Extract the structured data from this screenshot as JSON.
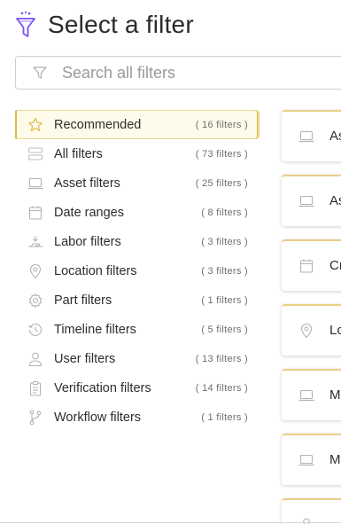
{
  "header": {
    "title": "Select a filter",
    "logo_icon": "funnel-icon"
  },
  "search": {
    "placeholder": "Search all filters",
    "value": "",
    "icon": "filter-icon"
  },
  "categories": [
    {
      "label": "Recommended",
      "count": "( 16 filters )",
      "icon": "star-icon",
      "active": true
    },
    {
      "label": "All filters",
      "count": "( 73 filters )",
      "icon": "stack-icon"
    },
    {
      "label": "Asset filters",
      "count": "( 25 filters )",
      "icon": "laptop-icon"
    },
    {
      "label": "Date ranges",
      "count": "( 8 filters )",
      "icon": "calendar-icon"
    },
    {
      "label": "Labor filters",
      "count": "( 3 filters )",
      "icon": "hand-icon"
    },
    {
      "label": "Location filters",
      "count": "( 3 filters )",
      "icon": "location-pin-icon"
    },
    {
      "label": "Part filters",
      "count": "( 1 filters )",
      "icon": "gear-icon"
    },
    {
      "label": "Timeline filters",
      "count": "( 5 filters )",
      "icon": "history-icon"
    },
    {
      "label": "User filters",
      "count": "( 13 filters )",
      "icon": "user-icon"
    },
    {
      "label": "Verification filters",
      "count": "( 14 filters )",
      "icon": "clipboard-icon"
    },
    {
      "label": "Workflow filters",
      "count": "( 1 filters )",
      "icon": "branch-icon"
    }
  ],
  "cards": [
    {
      "label": "As",
      "icon": "laptop-icon"
    },
    {
      "label": "As",
      "icon": "laptop-icon"
    },
    {
      "label": "Cr",
      "icon": "calendar-icon"
    },
    {
      "label": "Lo",
      "icon": "location-pin-icon"
    },
    {
      "label": "M",
      "icon": "laptop-icon"
    },
    {
      "label": "M",
      "icon": "laptop-icon"
    },
    {
      "label": "",
      "icon": "user-icon"
    }
  ],
  "colors": {
    "accent": "#e0b84a",
    "active_bg": "#fffbea",
    "logo": "#7b4ff0"
  }
}
